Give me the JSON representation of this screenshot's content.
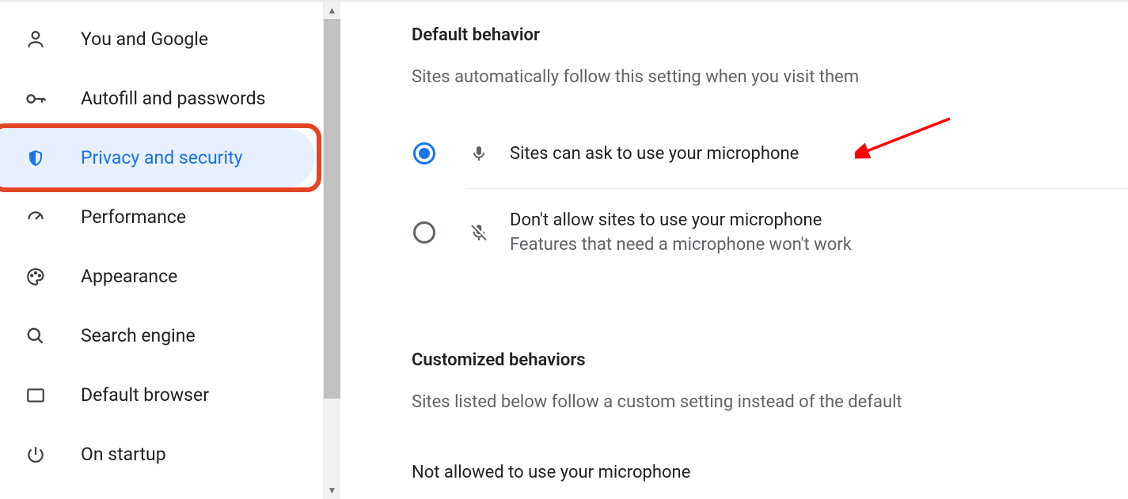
{
  "sidebar": {
    "items": [
      {
        "label": "You and Google"
      },
      {
        "label": "Autofill and passwords"
      },
      {
        "label": "Privacy and security"
      },
      {
        "label": "Performance"
      },
      {
        "label": "Appearance"
      },
      {
        "label": "Search engine"
      },
      {
        "label": "Default browser"
      },
      {
        "label": "On startup"
      }
    ]
  },
  "main": {
    "default_behavior": {
      "heading": "Default behavior",
      "subtext": "Sites automatically follow this setting when you visit them",
      "option_allow": "Sites can ask to use your microphone",
      "option_block_title": "Don't allow sites to use your microphone",
      "option_block_desc": "Features that need a microphone won't work"
    },
    "customized": {
      "heading": "Customized behaviors",
      "subtext": "Sites listed below follow a custom setting instead of the default",
      "not_allowed_heading": "Not allowed to use your microphone"
    }
  }
}
